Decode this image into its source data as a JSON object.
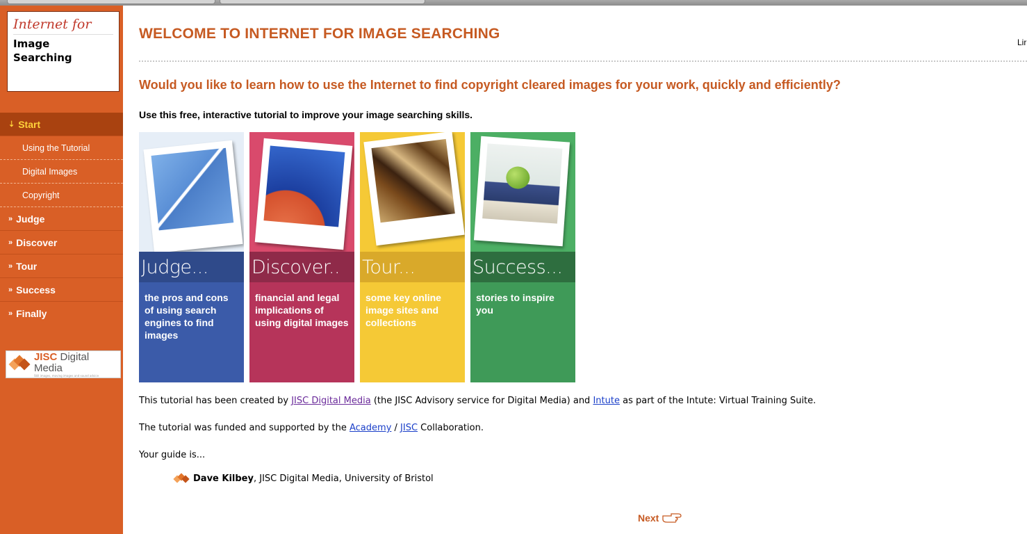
{
  "sidebar": {
    "logo_script": "Internet for",
    "logo_title": "Image Searching",
    "nav": [
      {
        "label": "Start",
        "active": true,
        "arrow": "↕"
      },
      {
        "label": "Using the Tutorial",
        "sub": true
      },
      {
        "label": "Digital Images",
        "sub": true
      },
      {
        "label": "Copyright",
        "sub": true
      },
      {
        "label": "Judge",
        "arrow": "»"
      },
      {
        "label": "Discover",
        "arrow": "»"
      },
      {
        "label": "Tour",
        "arrow": "»"
      },
      {
        "label": "Success",
        "arrow": "»"
      },
      {
        "label": "Finally",
        "arrow": "»"
      }
    ],
    "partner_logo": {
      "brand": "JISC",
      "text": "Digital Media",
      "tagline": "Still images, moving images and sound advice"
    }
  },
  "main": {
    "title": "WELCOME TO INTERNET FOR IMAGE SEARCHING",
    "top_link_fragment": "Lir",
    "subtitle": "Would you like to learn how to use the Internet to find copyright cleared images for your work, quickly and efficiently?",
    "intro": "Use this free, interactive tutorial to improve your image searching skills.",
    "panels": [
      {
        "heading": "Judge...",
        "text": "the pros and cons of using search engines to find images",
        "color": "#3b5ba9",
        "band": "#2f4a8a"
      },
      {
        "heading": "Discover..",
        "text": "financial and legal implications of using digital images",
        "color": "#b6345a",
        "band": "#8f2a49"
      },
      {
        "heading": "Tour...",
        "text": "some key online image sites and collections",
        "color": "#f5c936",
        "band": "#d9a92a"
      },
      {
        "heading": "Success...",
        "text": "stories to inspire you",
        "color": "#3f9a58",
        "band": "#2e6e3f"
      }
    ],
    "credit": {
      "p1_before": "This tutorial has been created by ",
      "p1_link1": "JISC Digital Media",
      "p1_mid": " (the JISC Advisory service for Digital Media) and ",
      "p1_link2": "Intute",
      "p1_after": " as part of the Intute: Virtual Training Suite.",
      "p2_before": "The tutorial was funded and supported by the ",
      "p2_link1": "Academy",
      "p2_sep": " / ",
      "p2_link2": "JISC",
      "p2_after": " Collaboration.",
      "p3": "Your guide is...",
      "guide_name": "Dave Kilbey",
      "guide_affil": ", JISC Digital Media, University of Bristol"
    },
    "next_label": "Next"
  }
}
